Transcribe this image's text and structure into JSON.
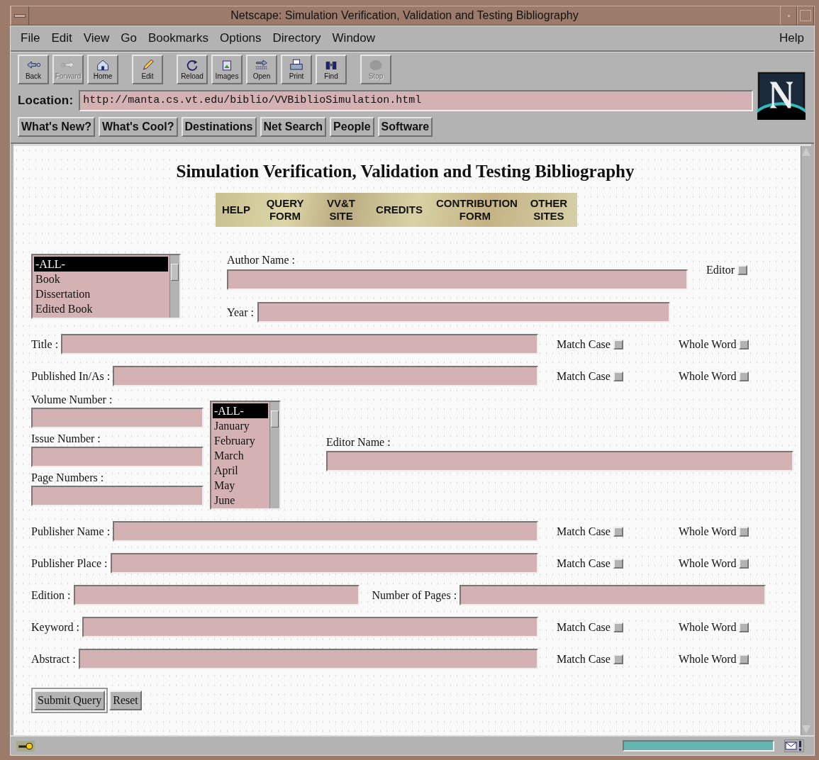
{
  "window": {
    "title": "Netscape: Simulation Verification, Validation and Testing Bibliography"
  },
  "menu": [
    "File",
    "Edit",
    "View",
    "Go",
    "Bookmarks",
    "Options",
    "Directory",
    "Window"
  ],
  "help_menu": "Help",
  "toolbar": [
    {
      "label": "Back",
      "kind": "back",
      "disabled": false
    },
    {
      "label": "Forward",
      "kind": "forward",
      "disabled": true
    },
    {
      "label": "Home",
      "kind": "home",
      "disabled": false
    },
    {
      "label": "Edit",
      "kind": "edit",
      "disabled": false
    },
    {
      "label": "Reload",
      "kind": "reload",
      "disabled": false
    },
    {
      "label": "Images",
      "kind": "images",
      "disabled": false
    },
    {
      "label": "Open",
      "kind": "open",
      "disabled": false
    },
    {
      "label": "Print",
      "kind": "print",
      "disabled": false
    },
    {
      "label": "Find",
      "kind": "find",
      "disabled": false
    },
    {
      "label": "Stop",
      "kind": "stop",
      "disabled": true
    }
  ],
  "location": {
    "label": "Location:",
    "value": "http://manta.cs.vt.edu/biblio/VVBiblioSimulation.html"
  },
  "directory_buttons": [
    "What's New?",
    "What's Cool?",
    "Destinations",
    "Net Search",
    "People",
    "Software"
  ],
  "page": {
    "heading": "Simulation Verification, Validation and Testing Bibliography",
    "nav": [
      "HELP",
      "QUERY FORM",
      "VV&T SITE",
      "CREDITS",
      "CONTRIBUTION FORM",
      "OTHER SITES"
    ],
    "type_list": [
      {
        "label": "-ALL-",
        "selected": true
      },
      {
        "label": "Book",
        "selected": false
      },
      {
        "label": "Dissertation",
        "selected": false
      },
      {
        "label": "Edited Book",
        "selected": false
      }
    ],
    "author": {
      "label": "Author Name :"
    },
    "editor": {
      "label": "Editor",
      "checked": false
    },
    "year": {
      "label": "Year :"
    },
    "upper_rows": [
      {
        "label": "Title :",
        "options": [
          {
            "label": "Match Case",
            "checked": false
          },
          {
            "label": "Whole Word",
            "checked": false
          }
        ]
      },
      {
        "label": "Published In/As :",
        "options": [
          {
            "label": "Match Case",
            "checked": false
          },
          {
            "label": "Whole Word",
            "checked": false
          }
        ]
      }
    ],
    "number_fields": [
      {
        "label": "Volume Number :"
      },
      {
        "label": "Issue Number :"
      },
      {
        "label": "Page Numbers :"
      }
    ],
    "month_list": [
      {
        "label": "-ALL-",
        "selected": true
      },
      {
        "label": "January",
        "selected": false
      },
      {
        "label": "February",
        "selected": false
      },
      {
        "label": "March",
        "selected": false
      },
      {
        "label": "April",
        "selected": false
      },
      {
        "label": "May",
        "selected": false
      },
      {
        "label": "June",
        "selected": false
      }
    ],
    "editor_name": {
      "label": "Editor Name :"
    },
    "publisher_rows": [
      {
        "label": "Publisher Name :",
        "options": [
          {
            "label": "Match Case",
            "checked": false
          },
          {
            "label": "Whole Word",
            "checked": false
          }
        ]
      },
      {
        "label": "Publisher Place :",
        "options": [
          {
            "label": "Match Case",
            "checked": false
          },
          {
            "label": "Whole Word",
            "checked": false
          }
        ]
      }
    ],
    "edition": {
      "label": "Edition :"
    },
    "pages": {
      "label": "Number of Pages :"
    },
    "lower_rows": [
      {
        "label": "Keyword :",
        "options": [
          {
            "label": "Match Case",
            "checked": false
          },
          {
            "label": "Whole Word",
            "checked": false
          }
        ]
      },
      {
        "label": "Abstract :",
        "options": [
          {
            "label": "Match Case",
            "checked": false
          },
          {
            "label": "Whole Word",
            "checked": false
          }
        ]
      }
    ],
    "buttons": [
      "Submit Query",
      "Reset"
    ]
  }
}
